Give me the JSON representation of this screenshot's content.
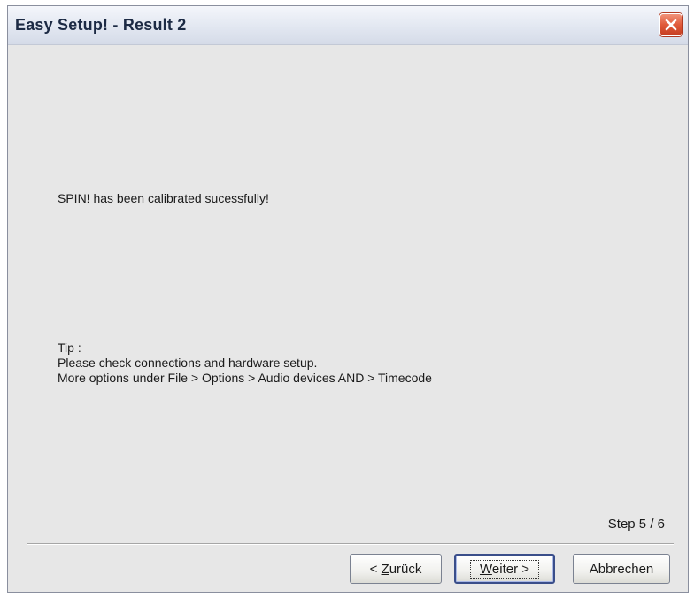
{
  "window": {
    "title": "Easy Setup! - Result 2"
  },
  "content": {
    "message": "SPIN! has been calibrated sucessfully!",
    "tip_heading": "Tip :",
    "tip_line1": "Please check connections and hardware setup.",
    "tip_line2": "More options under File > Options > Audio devices AND > Timecode",
    "step": "Step 5 / 6"
  },
  "buttons": {
    "back_prefix": "< ",
    "back_mnemonic": "Z",
    "back_rest": "urück",
    "next_mnemonic": "W",
    "next_rest": "eiter >",
    "cancel": "Abbrechen"
  },
  "icons": {
    "close": "close-x-icon"
  },
  "colors": {
    "close_button": "#e05a3a",
    "dialog_background": "#e7e7e7",
    "default_button_border": "#3a4e8a"
  }
}
